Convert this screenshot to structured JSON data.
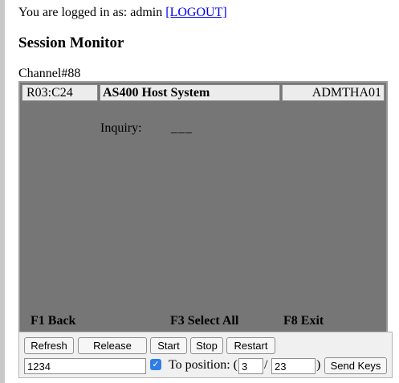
{
  "session": {
    "logged_in_text": "You are logged in as: admin",
    "logout_label": "[LOGOUT]"
  },
  "page": {
    "title": "Session Monitor",
    "channel": "Channel#88"
  },
  "terminal": {
    "cursor_position": "R03:C24",
    "system_name": "AS400 Host System",
    "user_id": "ADMTHA01",
    "inquiry_label": "Inquiry:",
    "inquiry_field": "___",
    "fkeys": [
      "F1 Back",
      "F3 Select All",
      "F8 Exit"
    ],
    "background_color": "#767676"
  },
  "controls": {
    "buttons": {
      "refresh": "Refresh",
      "release": "Release",
      "start": "Start",
      "stop": "Stop",
      "restart": "Restart",
      "send_keys": "Send Keys"
    },
    "keys_input_value": "1234",
    "to_position_checked": true,
    "to_position_label": "To position: (",
    "slash": "/",
    "close_paren": ")",
    "position_row": "3",
    "position_col": "23",
    "checkbox_color": "#2e7de8"
  }
}
